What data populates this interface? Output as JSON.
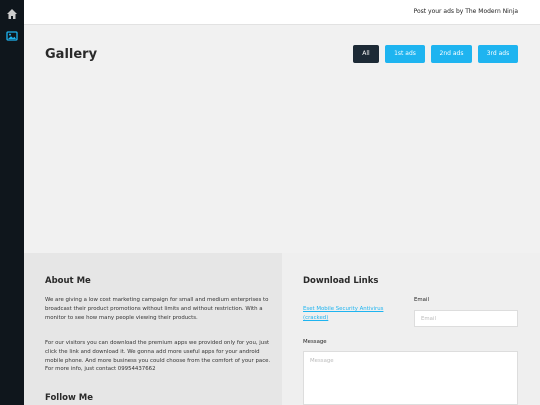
{
  "sidebar": {
    "icons": [
      {
        "name": "home-icon",
        "color": "#cccccc"
      },
      {
        "name": "photo-icon",
        "color": "#1eb4f0"
      }
    ]
  },
  "topbar": {
    "tagline": "Post your ads by The Modern Ninja"
  },
  "gallery": {
    "title": "Gallery",
    "filters": [
      {
        "label": "All",
        "active": true
      },
      {
        "label": "1st ads",
        "active": false
      },
      {
        "label": "2nd ads",
        "active": false
      },
      {
        "label": "3rd ads",
        "active": false
      }
    ]
  },
  "about": {
    "title": "About Me",
    "paragraph1": "We are giving a low cost marketing campaign for small and medium enterprises to broadcast their product promotions without limits and without restriction. With a monitor to see how many people viewing their products.",
    "paragraph2": "For our visitors you can download the premium apps we provided only for you, just click the link and download it. We gonna add more useful apps for your android mobile phone. And more business you could choose from the comfort of your pace. For more info, just contact 09954437662",
    "follow_title": "Follow Me"
  },
  "downloads": {
    "title": "Download Links",
    "link_label": "Eset Mobile Security Antivirus (cracked)",
    "email_label": "Email",
    "email_placeholder": "Email",
    "message_label": "Message",
    "message_placeholder": "Message"
  },
  "colors": {
    "accent": "#1eb4f0",
    "sidebar": "#0f161c",
    "active_button": "#1d2a36"
  }
}
